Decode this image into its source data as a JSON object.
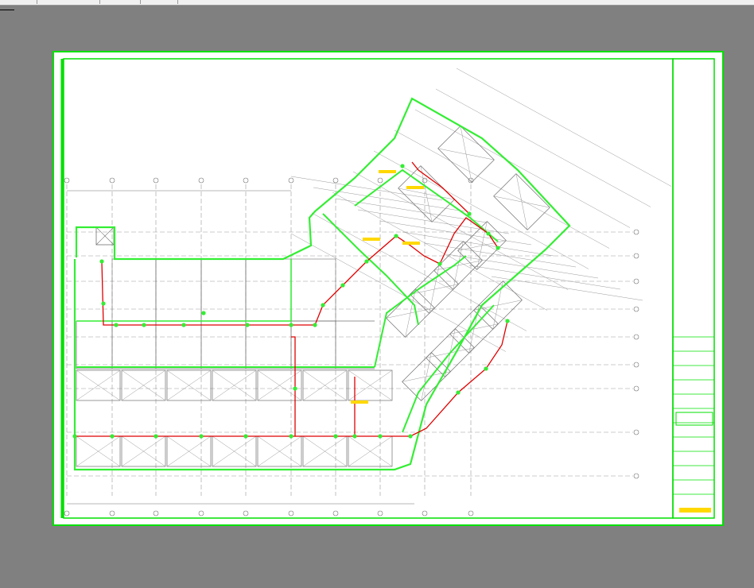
{
  "viewer": {
    "background": "#808080",
    "tabs": [
      "",
      "",
      "",
      ""
    ]
  },
  "drawing": {
    "colors": {
      "frame": "#00e000",
      "walls": "#33ee33",
      "pipe": "#e00000",
      "tag": "#ffd800",
      "grid": "#9a9a9a",
      "lines": "#707070"
    },
    "title_block": {
      "rows": 12
    }
  }
}
